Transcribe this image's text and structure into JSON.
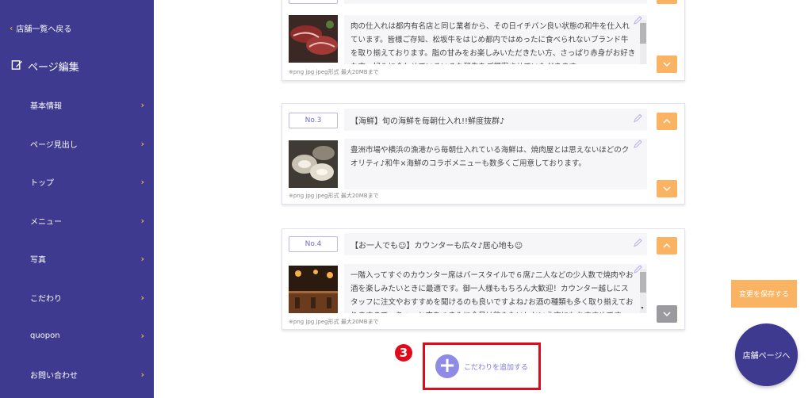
{
  "sidebar": {
    "back_label": "店舗一覧へ戻る",
    "section_title": "ページ編集",
    "items": [
      {
        "label": "基本情報"
      },
      {
        "label": "ページ見出し"
      },
      {
        "label": "トップ"
      },
      {
        "label": "メニュー"
      },
      {
        "label": "写真"
      },
      {
        "label": "こだわり"
      },
      {
        "label": "quopon"
      },
      {
        "label": "お問い合わせ"
      }
    ]
  },
  "cards": [
    {
      "description": "肉の仕入れは都内有名店と同じ業者から、その日イチバン良い状態の和牛を仕入れています。皆様ご存知、松坂牛をはじめ都内ではめったに食べられないブランド牛を取り揃えております。脂の甘みをお楽しみいただきたい方、さっぱり赤身がお好きな方、好みに合わせていろいろな和牛をご提案させていただきます。",
      "hint": "※png jpg jpeg形式 最大20MBまで"
    },
    {
      "number": "No.3",
      "title": "【海鮮】旬の海鮮を毎朝仕入れ!!鮮度抜群♪",
      "description": "豊洲市場や横浜の漁港から毎朝仕入れている海鮮は、焼肉屋とは思えないほどのクオリティ♪和牛×海鮮のコラボメニューも数多くご用意しております。",
      "hint": "※png jpg jpeg形式 最大20MBまで"
    },
    {
      "number": "No.4",
      "title": "【お一人でも☺】カウンターも広々♪居心地も☺",
      "description": "一階入ってすぐのカウンター席はバースタイルで６席♪二人などの少人数で焼肉やお酒を楽しみたいときに最適です。御一人様ももちろん大歓迎！カウンター越しにスタッフに注文やおすすめを聞けるのも良いですよね♪お酒の種類も多く取り揃えておりますので、ちょっと肉をつまみに今日は飲みたい！という方にもおすすめです。",
      "hint": "※png jpg jpeg形式 最大20MBまで"
    }
  ],
  "step_badge": "3",
  "add_label": "こだわりを追加する",
  "save_label": "変更を保存する",
  "store_label": "店舗ページへ",
  "colors": {
    "sidebar": "#3d3a8f",
    "accent_orange": "#f9b362",
    "accent_purple": "#8f8ae6",
    "highlight_red": "#e00a1b"
  }
}
